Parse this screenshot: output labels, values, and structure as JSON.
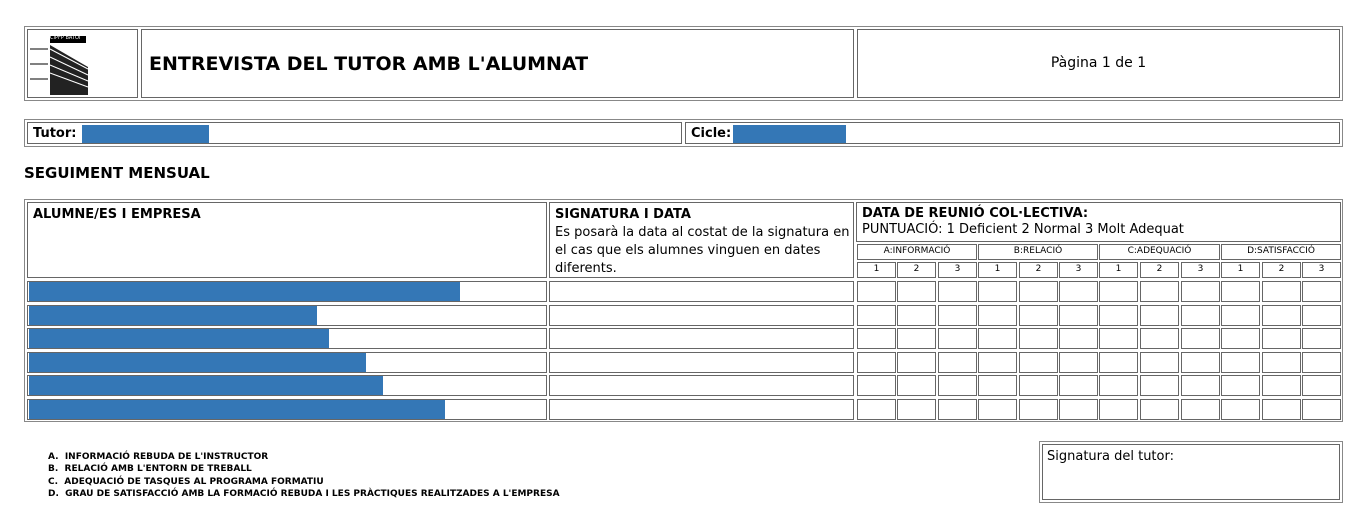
{
  "header": {
    "logo_text": "CIPFP BATOI",
    "title": "ENTREVISTA DEL TUTOR AMB L'ALUMNAT",
    "page_info": "Pàgina 1 de 1"
  },
  "info_row": {
    "tutor_label": "Tutor:",
    "cicle_label": "Cicle:"
  },
  "section_title": "SEGUIMENT MENSUAL",
  "table": {
    "col1_header": "ALUMNE/ES I EMPRESA",
    "col2_header": "SIGNATURA I DATA",
    "col2_note": "Es posarà la data al costat de la signatura en el cas que els alumnes vinguen en dates diferents.",
    "col3_header": "DATA DE REUNIÓ COL·LECTIVA:",
    "scale": "PUNTUACIÓ: 1 Deficient 2 Normal 3 Molt Adequat",
    "groups": [
      "A:INFORMACIÓ",
      "B:RELACIÓ",
      "C:ADEQUACIÓ",
      "D:SATISFACCIÓ"
    ],
    "scores": [
      "1",
      "2",
      "3"
    ]
  },
  "legend": [
    "A.  INFORMACIÓ REBUDA DE L'INSTRUCTOR",
    "B.  RELACIÓ AMB L'ENTORN DE TREBALL",
    "C.  ADEQUACIÓ DE TASQUES AL PROGRAMA FORMATIU",
    "D.  GRAU DE SATISFACCIÓ AMB LA FORMACIÓ REBUDA I LES PRÀCTIQUES REALITZADES A L'EMPRESA"
  ],
  "signature_label": "Signatura del tutor:"
}
